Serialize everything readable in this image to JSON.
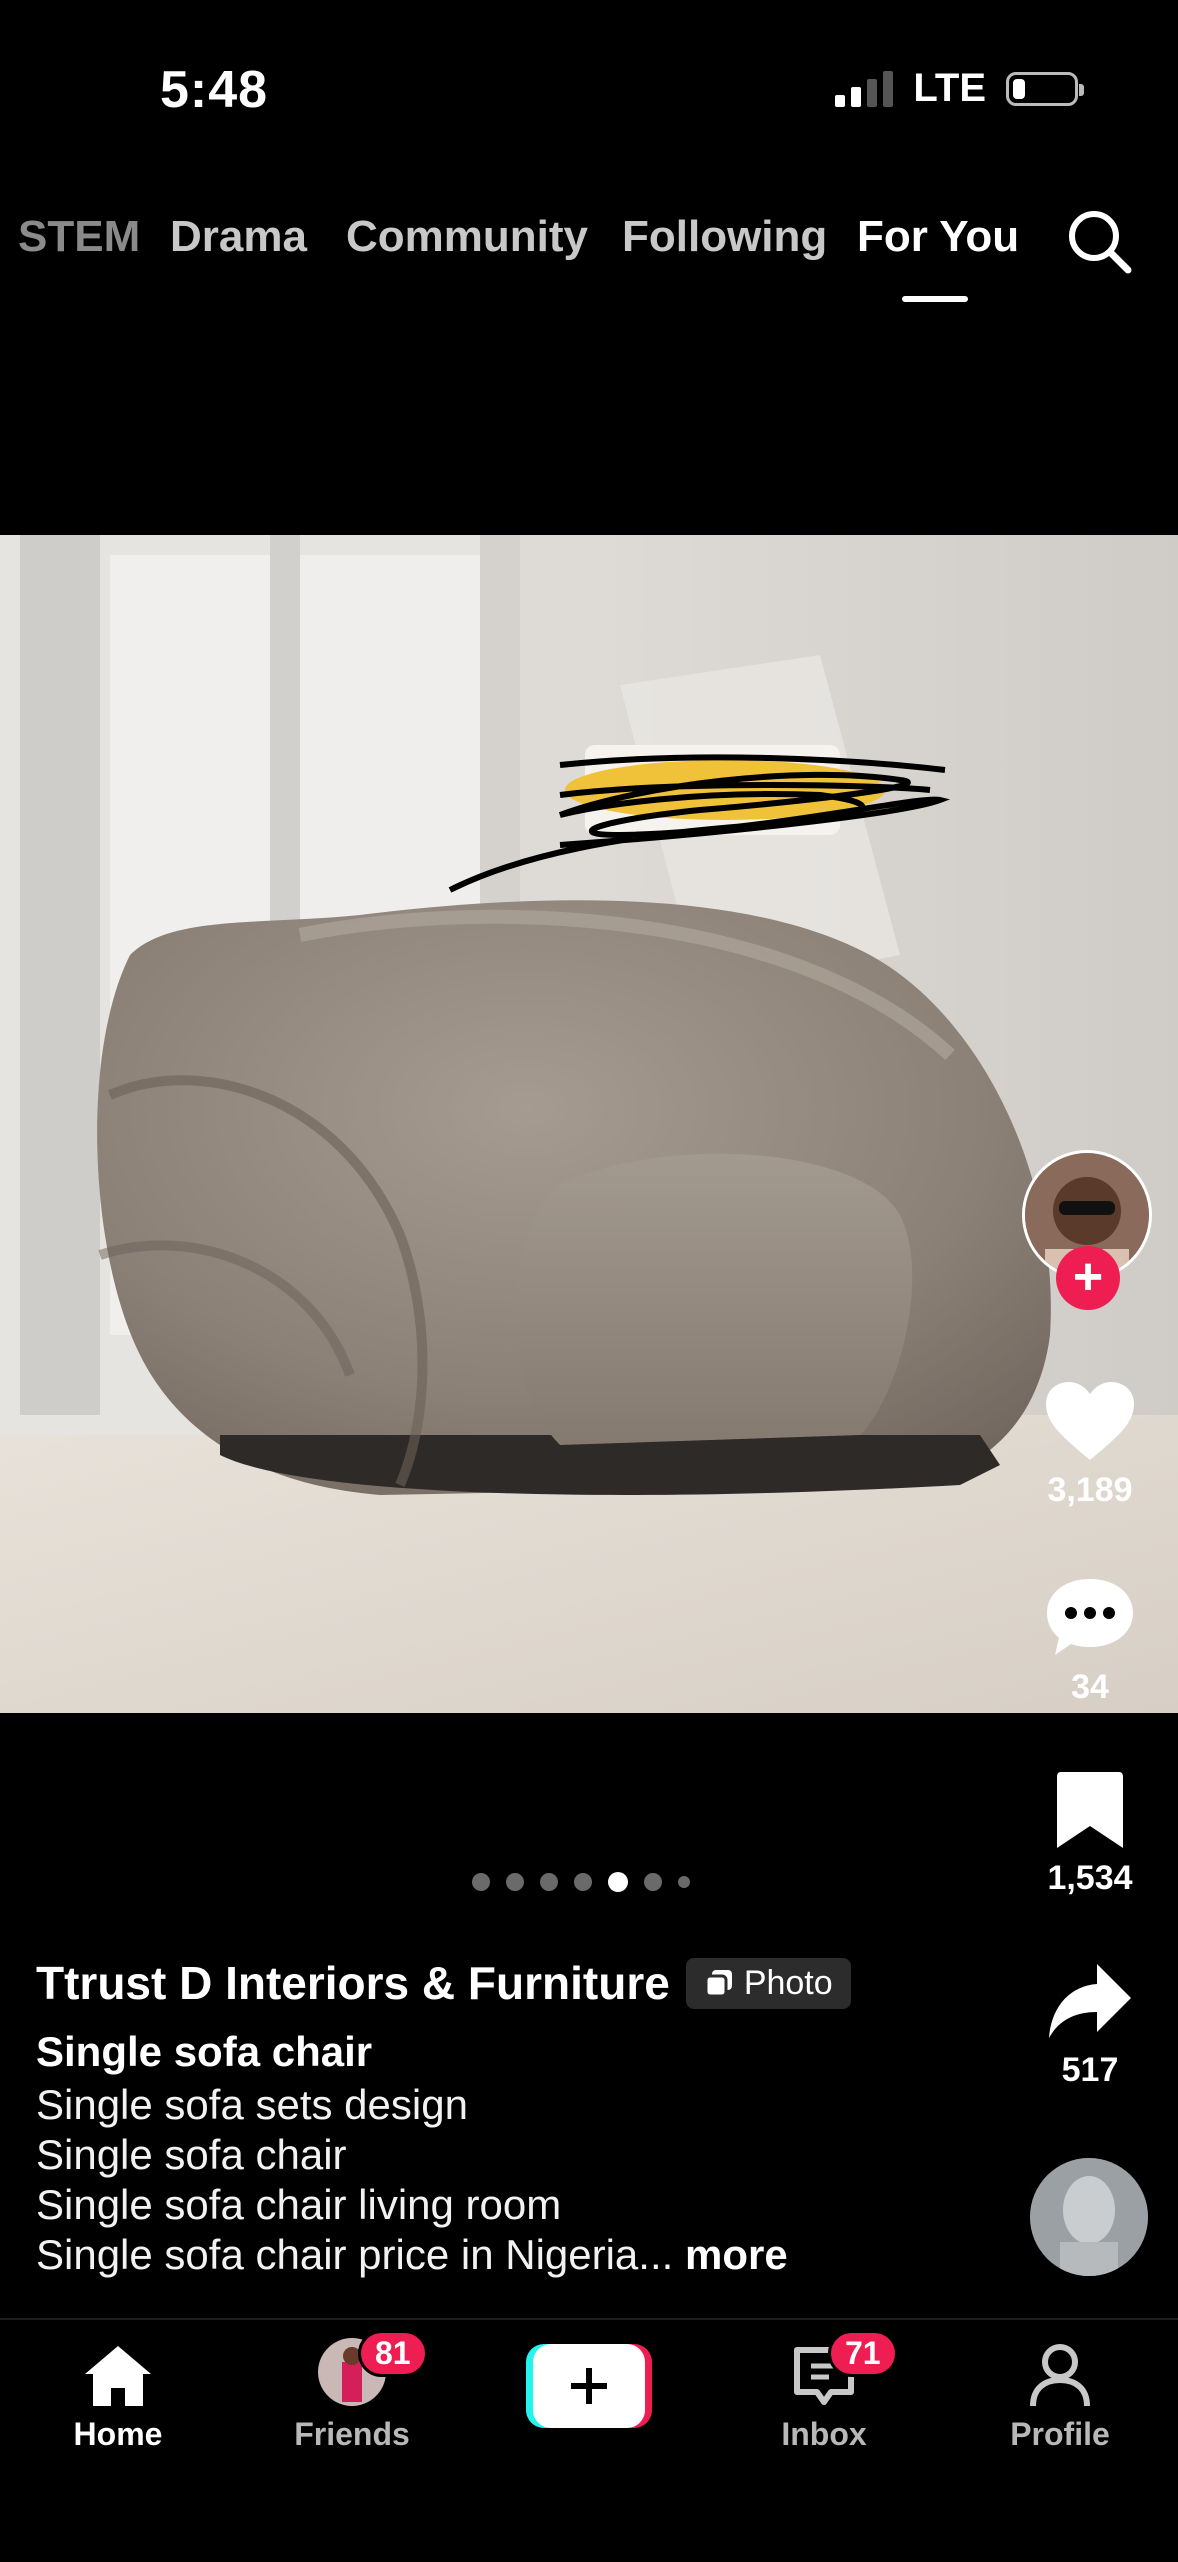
{
  "status_bar": {
    "time": "5:48",
    "network": "LTE"
  },
  "top_nav": {
    "tabs": [
      {
        "label": "STEM"
      },
      {
        "label": "Drama"
      },
      {
        "label": "Community"
      },
      {
        "label": "Following"
      },
      {
        "label": "For You"
      }
    ],
    "active_tab": "For You"
  },
  "post": {
    "author": "Ttrust D Interiors & Furniture",
    "badge": "Photo",
    "title": "Single sofa chair",
    "caption_lines": [
      "Single sofa sets design",
      "Single sofa chair",
      "Single sofa chair living room",
      "Single sofa chair price in Nigeria..."
    ],
    "more_label": "more",
    "carousel": {
      "total": 7,
      "current": 5
    }
  },
  "actions": {
    "likes": "3,189",
    "comments": "34",
    "saves": "1,534",
    "shares": "517"
  },
  "bottom_nav": {
    "home": "Home",
    "friends": "Friends",
    "friends_badge": "81",
    "inbox": "Inbox",
    "inbox_badge": "71",
    "profile": "Profile"
  },
  "colors": {
    "accent": "#ee1d52",
    "cyan": "#25f4ee",
    "background": "#000000"
  }
}
